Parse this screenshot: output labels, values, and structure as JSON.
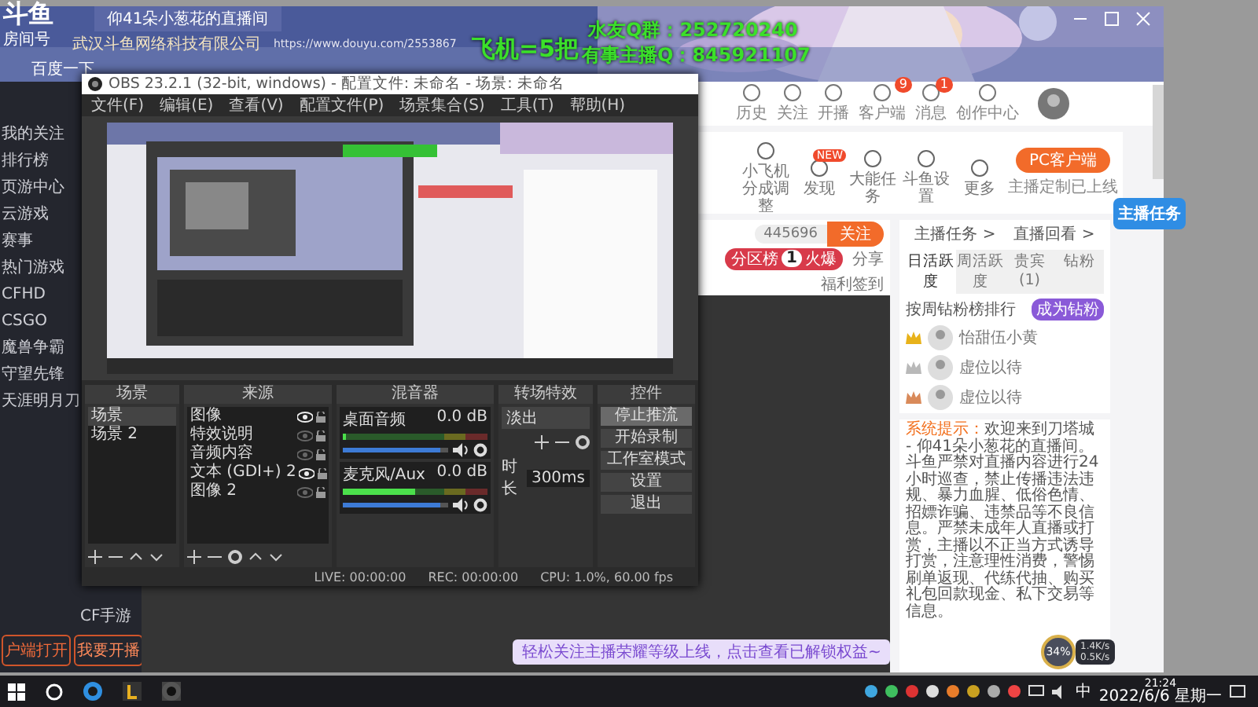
{
  "overlay": {
    "logo": "斗鱼",
    "room_label": "房间号",
    "promo": "飞机=5把",
    "qq_group": "水友Q群：252720240",
    "anchor_qq": "有事主播Q：845921107"
  },
  "browser": {
    "tab_title": "仰41朵小葱花的直播间",
    "site_name": "武汉斗鱼网络科技有限公司",
    "url": "https://www.douyu.com/2553867",
    "bookmarks": [
      "百度一下"
    ],
    "header_icons": [
      {
        "label": "历史"
      },
      {
        "label": "关注"
      },
      {
        "label": "开播"
      },
      {
        "label": "客户端",
        "badge": "9"
      },
      {
        "label": "消息",
        "badge": "1"
      },
      {
        "label": "创作中心"
      }
    ],
    "categories": [
      {
        "label": "小飞机分成调整"
      },
      {
        "label": "发现",
        "badge": "NEW"
      },
      {
        "label": "大能任务"
      },
      {
        "label": "斗鱼设置"
      },
      {
        "label": "更多"
      }
    ],
    "client_button": "PC客户端",
    "client_note": "主播定制已上线",
    "sidebar": {
      "items": [
        "我的关注",
        "排行榜",
        "页游中心",
        "云游戏",
        "赛事",
        "热门游戏",
        "CFHD",
        "CSGO",
        "魔兽争霸",
        "守望先锋",
        "天涯明月刀"
      ],
      "lower_item": "CF手游",
      "buttons": [
        "户端打开",
        "我要开播"
      ]
    },
    "room": {
      "followers": "445696",
      "follow": "关注",
      "rank": [
        "分区榜",
        "1",
        "火爆"
      ],
      "share": "分享",
      "checkin": "福利签到"
    },
    "rank_card": {
      "links": [
        "主播任务 >",
        "直播回看 >"
      ],
      "tabs": [
        {
          "label": "日活跃度",
          "selected": true
        },
        {
          "label": "周活跃度",
          "selected": false
        },
        {
          "label": "贵宾(1)",
          "selected": false
        },
        {
          "label": "钻粉",
          "selected": false
        }
      ],
      "heading": "按周钻粉榜排行",
      "join": "成为钻粉",
      "rows": [
        {
          "name": "怡甜伍小黄",
          "color": "#e8b21a"
        },
        {
          "name": "虚位以待",
          "color": "#b9b9b9"
        },
        {
          "name": "虚位以待",
          "color": "#d98a5a"
        }
      ]
    },
    "task_badge": "主播任务",
    "chat": {
      "label": "系统提示：",
      "text": "欢迎来到刀塔城 - 仰41朵小葱花的直播间。斗鱼严禁对直播内容进行24小时巡查，禁止传播违法违规、暴力血腥、低俗色情、招嫖诈骗、违禁品等不良信息。严禁未成年人直播或打赏，主播以不正当方式诱导打赏，注意理性消费，警惕刷单返现、代练代抽、购买礼包回款现金、私下交易等信息。"
    },
    "toast": "轻松关注主播荣耀等级上线，点击查看已解锁权益~"
  },
  "obs": {
    "title": "OBS 23.2.1 (32-bit, windows) - 配置文件: 未命名 - 场景: 未命名",
    "menu": [
      "文件(F)",
      "编辑(E)",
      "查看(V)",
      "配置文件(P)",
      "场景集合(S)",
      "工具(T)",
      "帮助(H)"
    ],
    "docks": {
      "scenes": "场景",
      "sources": "来源",
      "mixer": "混音器",
      "transitions": "转场特效",
      "controls": "控件"
    },
    "scenes": [
      {
        "name": "场景",
        "selected": true
      },
      {
        "name": "场景 2",
        "selected": false
      }
    ],
    "sources": [
      {
        "name": "图像",
        "visible": true
      },
      {
        "name": "特效说明",
        "visible": false
      },
      {
        "name": "音频内容",
        "visible": false
      },
      {
        "name": "文本 (GDI+) 2",
        "visible": true
      },
      {
        "name": "图像 2",
        "visible": false
      }
    ],
    "mixer": [
      {
        "name": "桌面音频",
        "reading": "0.0 dB",
        "meter": {
          "level": 0.02
        },
        "volume": {
          "level": 0.92
        }
      },
      {
        "name": "麦克风/Aux",
        "reading": "0.0 dB",
        "meter": {
          "level": 0.5
        },
        "volume": {
          "level": 0.92
        }
      }
    ],
    "transition": {
      "value": "淡出",
      "duration_label": "时长",
      "duration": "300ms"
    },
    "controls": [
      {
        "label": "停止推流",
        "active": true
      },
      {
        "label": "开始录制",
        "active": false
      },
      {
        "label": "工作室模式",
        "active": false
      },
      {
        "label": "设置",
        "active": false
      },
      {
        "label": "退出",
        "active": false
      }
    ],
    "status": [
      "LIVE: 00:00:00",
      "REC: 00:00:00",
      "CPU: 1.0%, 60.00 fps"
    ]
  },
  "speed_widget": {
    "percent": "34%",
    "up": "1.4K/s",
    "down": "0.5K/s"
  },
  "taskbar": {
    "ime": "中",
    "time": "21:24",
    "date": "2022/6/6 星期一"
  }
}
